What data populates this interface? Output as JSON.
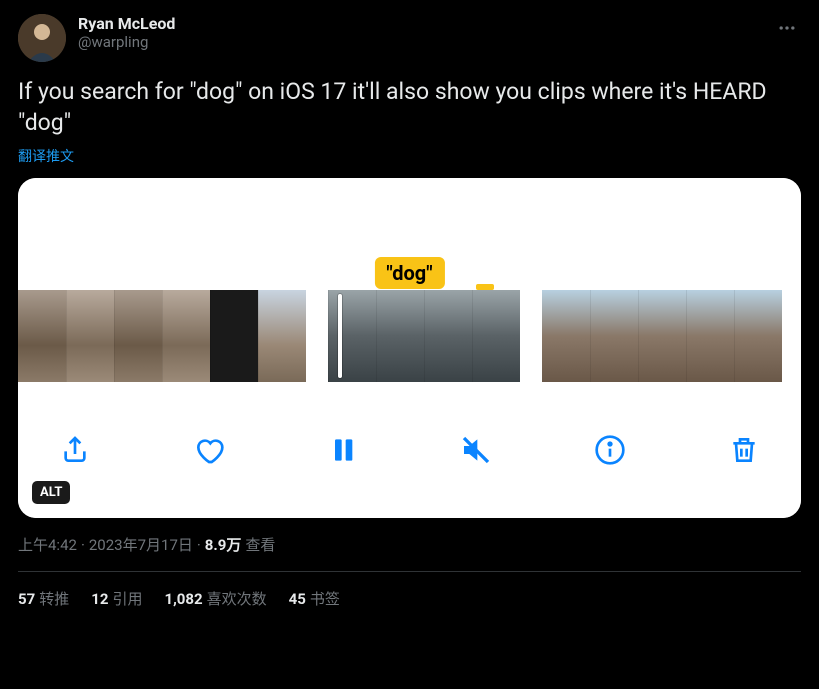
{
  "author": {
    "display_name": "Ryan McLeod",
    "handle": "@warpling"
  },
  "tweet_text": "If you search for \"dog\" on iOS 17 it'll also show you clips where it's HEARD \"dog\"",
  "translate_label": "翻译推文",
  "media": {
    "search_tag": "\"dog\"",
    "alt_badge": "ALT"
  },
  "meta": {
    "time": "上午4:42",
    "date": "2023年7月17日",
    "views_count": "8.9万",
    "views_label": "查看"
  },
  "stats": {
    "retweets_count": "57",
    "retweets_label": "转推",
    "quotes_count": "12",
    "quotes_label": "引用",
    "likes_count": "1,082",
    "likes_label": "喜欢次数",
    "bookmarks_count": "45",
    "bookmarks_label": "书签"
  }
}
